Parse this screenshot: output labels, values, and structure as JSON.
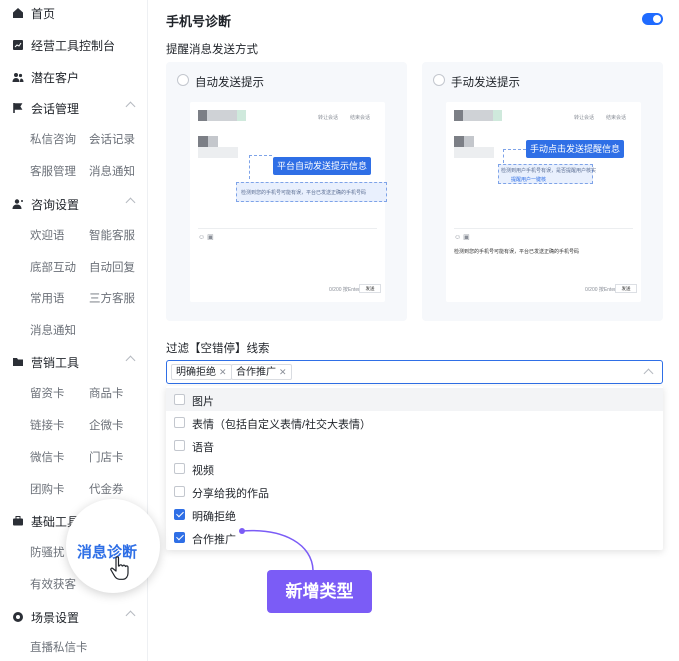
{
  "sidebar": {
    "groups": [
      {
        "label": "首页",
        "icon": "home-icon"
      },
      {
        "label": "经营工具控制台",
        "icon": "chart-icon"
      },
      {
        "label": "潜在客户",
        "icon": "users-icon"
      },
      {
        "label": "会话管理",
        "icon": "flag-icon"
      },
      {
        "label": "咨询设置",
        "icon": "user-settings-icon"
      },
      {
        "label": "营销工具",
        "icon": "folder-icon"
      },
      {
        "label": "基础工具",
        "icon": "briefcase-icon"
      },
      {
        "label": "场景设置",
        "icon": "gear-icon"
      }
    ],
    "session_items": [
      "私信咨询",
      "会话记录",
      "客服管理",
      "消息通知"
    ],
    "consult_items": [
      "欢迎语",
      "智能客服",
      "底部互动",
      "自动回复",
      "常用语",
      "三方客服",
      "消息通知"
    ],
    "marketing_items": [
      "留资卡",
      "商品卡",
      "链接卡",
      "企微卡",
      "微信卡",
      "门店卡",
      "团购卡",
      "代金券"
    ],
    "basic_items": [
      "防骚扰",
      "有效获客"
    ],
    "scene_items": [
      "直播私信卡"
    ]
  },
  "main": {
    "title": "手机号诊断",
    "toggle_on": true,
    "reminder_label": "提醒消息发送方式",
    "auto_card": {
      "label": "自动发送提示",
      "callout": "平台自动发送提示信息",
      "hint": "检测到您的手机号可能有误，平台已发送正确的手机号码",
      "action1": "转让会话",
      "action2": "结束会话",
      "send": "发送",
      "counter": "0/200 按Enter发送"
    },
    "manual_card": {
      "label": "手动发送提示",
      "callout": "手动点击发送提醒信息",
      "hint": "检测到用户手机号有误，是否提醒用户核实",
      "hint_btn": "提醒用户一键核",
      "msg": "检测到您的手机号可能有误，平台已发送正确的手机号码",
      "action1": "转让会话",
      "action2": "结束会话",
      "send": "发送",
      "counter": "0/200 按Enter发送"
    },
    "filter_label": "过滤【空错停】线索",
    "selected_tags": [
      "明确拒绝",
      "合作推广"
    ],
    "options": [
      {
        "label": "图片",
        "checked": false
      },
      {
        "label": "表情（包括自定义表情/社交大表情）",
        "checked": false
      },
      {
        "label": "语音",
        "checked": false
      },
      {
        "label": "视频",
        "checked": false
      },
      {
        "label": "分享给我的作品",
        "checked": false
      },
      {
        "label": "明确拒绝",
        "checked": true
      },
      {
        "label": "合作推广",
        "checked": true
      }
    ]
  },
  "overlays": {
    "magnifier_text": "消息诊断",
    "new_badge": "新增类型"
  },
  "colors": {
    "primary": "#2f6fe6",
    "badge": "#7b5cf6"
  }
}
